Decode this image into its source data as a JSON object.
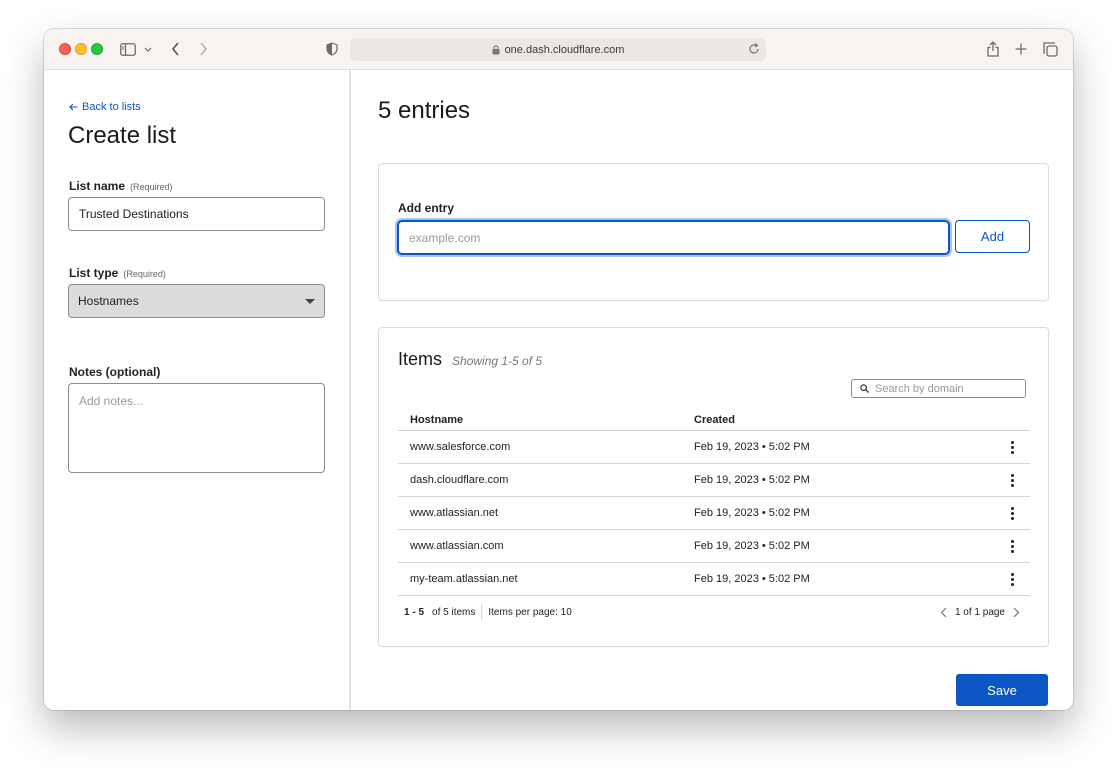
{
  "browser": {
    "url": "one.dash.cloudflare.com"
  },
  "sidebar": {
    "back_link": "Back to lists",
    "title": "Create list",
    "list_name": {
      "label": "List name",
      "required": "(Required)",
      "value": "Trusted Destinations"
    },
    "list_type": {
      "label": "List type",
      "required": "(Required)",
      "value": "Hostnames"
    },
    "notes": {
      "label": "Notes (optional)",
      "placeholder": "Add notes..."
    }
  },
  "main": {
    "title": "5 entries",
    "add_entry": {
      "label": "Add entry",
      "placeholder": "example.com",
      "button": "Add"
    },
    "items": {
      "title": "Items",
      "subtitle": "Showing 1-5 of 5",
      "search_placeholder": "Search by domain",
      "columns": {
        "hostname": "Hostname",
        "created": "Created"
      },
      "rows": [
        {
          "hostname": "www.salesforce.com",
          "created": "Feb 19, 2023 • 5:02 PM"
        },
        {
          "hostname": "dash.cloudflare.com",
          "created": "Feb 19, 2023 • 5:02 PM"
        },
        {
          "hostname": "www.atlassian.net",
          "created": "Feb 19, 2023 • 5:02 PM"
        },
        {
          "hostname": "www.atlassian.com",
          "created": "Feb 19, 2023 • 5:02 PM"
        },
        {
          "hostname": "my-team.atlassian.net",
          "created": "Feb 19, 2023 • 5:02 PM"
        }
      ],
      "pagination": {
        "range": "1 - 5",
        "of_items": "of 5 items",
        "per_page": "Items per page: 10",
        "pages": "1 of 1 page"
      }
    },
    "save_button": "Save"
  },
  "colors": {
    "accent": "#0b56c4"
  }
}
